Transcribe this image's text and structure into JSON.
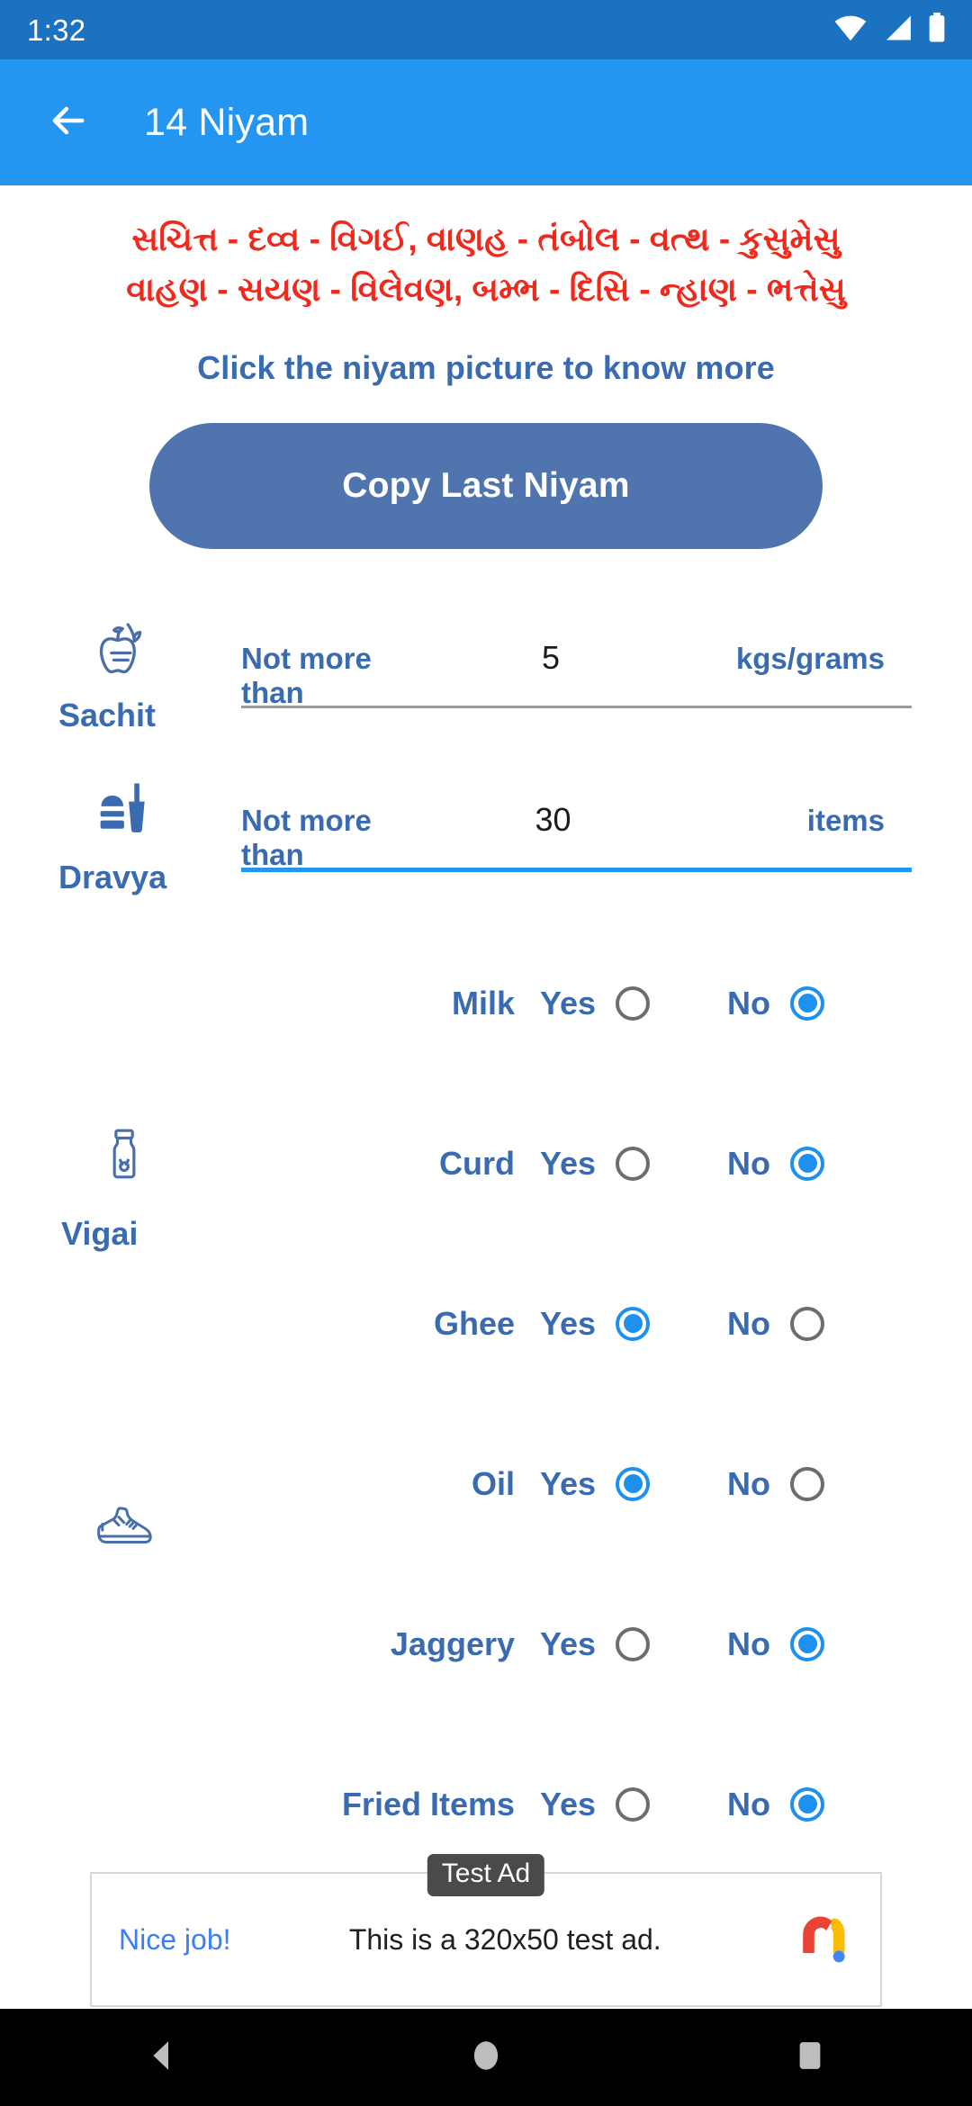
{
  "status_bar": {
    "clock": "1:32",
    "icons": [
      "wifi-icon",
      "cellular-signal-icon",
      "battery-icon"
    ]
  },
  "app_bar": {
    "back_icon": "back-arrow-icon",
    "title": "14 Niyam"
  },
  "verse": {
    "line1": "સચિત્ત - દવ્વ - વિગઈ, વાણહ - તંબોલ - વત્થ - કુસુમેસુ",
    "line2": "વાહણ - સયણ - વિલેવણ, બમ્ભ - દિસિ - ન્હાણ - ભત્તેસુ",
    "color": "#f0291c"
  },
  "hint": "Click the niyam picture to know more",
  "copy_button": {
    "label": "Copy Last Niyam",
    "color": "#4f74ae"
  },
  "fields": [
    {
      "name": "Sachit",
      "icon": "apple-fruit-icon",
      "prefix": "Not more than",
      "value": "5",
      "unit": "kgs/grams",
      "focused": false
    },
    {
      "name": "Dravya",
      "icon": "food-drink-icon",
      "prefix": "Not more than",
      "value": "30",
      "unit": "items",
      "focused": true
    }
  ],
  "vigai": {
    "group_name": "Vigai",
    "group_icon": "milk-bottle-icon",
    "yes_label": "Yes",
    "no_label": "No",
    "items": [
      {
        "label": "Milk",
        "selected": "no"
      },
      {
        "label": "Curd",
        "selected": "no"
      },
      {
        "label": "Ghee",
        "selected": "yes"
      },
      {
        "label": "Oil",
        "selected": "yes"
      },
      {
        "label": "Jaggery",
        "selected": "no"
      },
      {
        "label": "Fried Items",
        "selected": "no"
      }
    ]
  },
  "vanah": {
    "icon": "shoe-icon"
  },
  "ad": {
    "badge": "Test Ad",
    "cta": "Nice job!",
    "text": "This is a 320x50 test ad.",
    "logo": "admob-logo-icon"
  },
  "nav_bar": {
    "back": "nav-back-icon",
    "home": "nav-home-icon",
    "recents": "nav-recents-icon"
  },
  "colors": {
    "status_bar": "#1b72c0",
    "app_bar": "#2496f2",
    "accent_blue": "#3a6bb0",
    "radio_blue": "#1e90f0",
    "verse_red": "#f0291c"
  }
}
